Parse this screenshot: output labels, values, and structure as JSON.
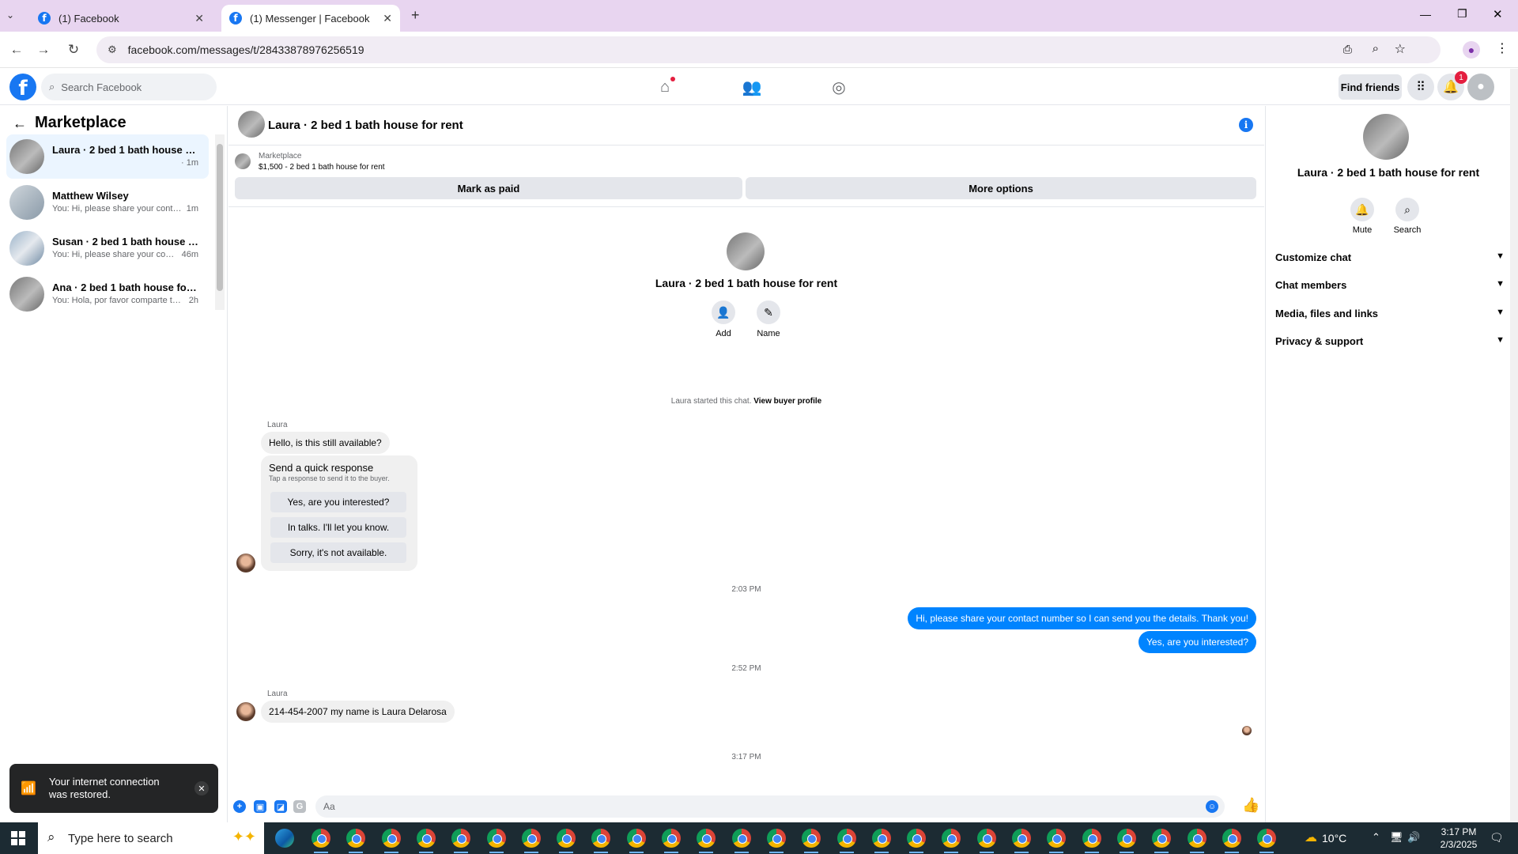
{
  "browser": {
    "tabs": [
      {
        "title": "(1) Facebook"
      },
      {
        "title": "(1) Messenger | Facebook"
      }
    ],
    "url": "facebook.com/messages/t/28433878976256519"
  },
  "fb_header": {
    "search_placeholder": "Search Facebook",
    "find_friends": "Find friends",
    "notification_count": "1"
  },
  "left_panel": {
    "title": "Marketplace",
    "conversations": [
      {
        "name": "Laura · 2 bed 1 bath house for r...",
        "preview": "",
        "time": "· 1m"
      },
      {
        "name": "Matthew Wilsey",
        "preview": "You: Hi, please share your contact...",
        "time": "1m"
      },
      {
        "name": "Susan · 2 bed 1 bath house for r...",
        "preview": "You: Hi, please share your conta...",
        "time": "46m"
      },
      {
        "name": "Ana · 2 bed 1 bath house for rent",
        "preview": "You: Hola, por favor comparte tu n...",
        "time": "2h"
      }
    ]
  },
  "toast": {
    "text": "Your internet connection was restored."
  },
  "chat": {
    "header_name": "Laura · 2 bed 1 bath house for rent",
    "marketplace_label": "Marketplace",
    "listing": "$1,500 - 2 bed 1 bath house for rent",
    "mark_paid": "Mark as paid",
    "more_options": "More options",
    "intro_name": "Laura · 2 bed 1 bath house for rent",
    "add_label": "Add",
    "name_label": "Name",
    "started_text": "Laura started this chat.",
    "view_buyer": "View buyer profile",
    "sender1": "Laura",
    "msg1": "Hello, is this still available?",
    "quick_title": "Send a quick response",
    "quick_sub": "Tap a response to send it to the buyer.",
    "quick_options": [
      "Yes, are you interested?",
      "In talks. I'll let you know.",
      "Sorry, it's not available."
    ],
    "time1": "2:03 PM",
    "out1": "Hi, please share your contact number so I can send you the details. Thank you!",
    "out2": "Yes, are you interested?",
    "time2": "2:52 PM",
    "sender2": "Laura",
    "msg2": "214-454-2007 my name is Laura Delarosa",
    "time3": "3:17 PM",
    "composer_placeholder": "Aa"
  },
  "right_panel": {
    "name": "Laura · 2 bed 1 bath house for rent",
    "mute": "Mute",
    "search": "Search",
    "items": [
      "Customize chat",
      "Chat members",
      "Media, files and links",
      "Privacy & support"
    ]
  },
  "taskbar": {
    "search_placeholder": "Type here to search",
    "temperature": "10°C",
    "time": "3:17 PM",
    "date": "2/3/2025"
  }
}
